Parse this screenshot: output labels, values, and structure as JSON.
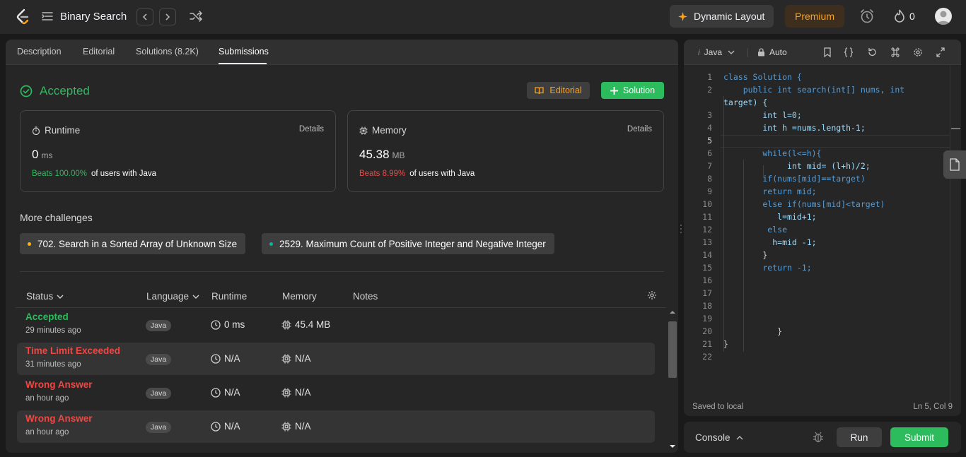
{
  "header": {
    "problem_title": "Binary Search",
    "dynamic_layout_label": "Dynamic Layout",
    "premium_label": "Premium",
    "streak_count": "0"
  },
  "tabs": [
    {
      "label": "Description"
    },
    {
      "label": "Editorial"
    },
    {
      "label": "Solutions (8.2K)"
    },
    {
      "label": "Submissions",
      "active": true
    }
  ],
  "result": {
    "status": "Accepted",
    "editorial_button": "Editorial",
    "solution_button": "Solution",
    "runtime": {
      "label": "Runtime",
      "details": "Details",
      "value": "0",
      "unit": "ms",
      "beats_text": "Beats 100.00%",
      "beats_suffix": "of users with Java"
    },
    "memory": {
      "label": "Memory",
      "details": "Details",
      "value": "45.38",
      "unit": "MB",
      "beats_text": "Beats 8.99%",
      "beats_suffix": "of users with Java"
    }
  },
  "more_challenges": {
    "title": "More challenges",
    "items": [
      {
        "label": "702. Search in a Sorted Array of Unknown Size",
        "dot_color": "#ffb800"
      },
      {
        "label": "2529. Maximum Count of Positive Integer and Negative Integer",
        "dot_color": "#00b8a3"
      }
    ]
  },
  "submissions_table": {
    "headers": {
      "status": "Status",
      "language": "Language",
      "runtime": "Runtime",
      "memory": "Memory",
      "notes": "Notes"
    },
    "rows": [
      {
        "status": "Accepted",
        "status_type": "ok",
        "time": "29 minutes ago",
        "language": "Java",
        "runtime": "0 ms",
        "memory": "45.4 MB"
      },
      {
        "status": "Time Limit Exceeded",
        "status_type": "fail",
        "time": "31 minutes ago",
        "language": "Java",
        "runtime": "N/A",
        "memory": "N/A"
      },
      {
        "status": "Wrong Answer",
        "status_type": "fail",
        "time": "an hour ago",
        "language": "Java",
        "runtime": "N/A",
        "memory": "N/A"
      },
      {
        "status": "Wrong Answer",
        "status_type": "fail",
        "time": "an hour ago",
        "language": "Java",
        "runtime": "N/A",
        "memory": "N/A"
      }
    ]
  },
  "editor": {
    "language": "Java",
    "mode": "Auto",
    "code_lines": [
      "class Solution {",
      "    public int search(int[] nums, int",
      "target) {",
      "        int l=0;",
      "        int h =nums.length-1;",
      "",
      "        while(l<=h){",
      "             int mid= (l+h)/2;",
      "        if(nums[mid]==target)",
      "        return mid;",
      "        else if(nums[mid]<target)",
      "           l=mid+1;",
      "         else",
      "          h=mid -1;",
      "        }",
      "        return -1;",
      "",
      "",
      "",
      "",
      "           }",
      "}"
    ],
    "line_numbers": [
      "1",
      "2",
      "",
      "3",
      "4",
      "5",
      "6",
      "7",
      "8",
      "9",
      "10",
      "11",
      "12",
      "13",
      "14",
      "15",
      "16",
      "17",
      "18",
      "19",
      "20",
      "21",
      "22"
    ],
    "saved_status": "Saved to local",
    "cursor_position": "Ln 5, Col 9"
  },
  "console": {
    "label": "Console",
    "run_label": "Run",
    "submit_label": "Submit"
  },
  "colors": {
    "accent_green": "#2cbb5d",
    "accent_red": "#ef4743",
    "accent_orange": "#ffa116"
  }
}
